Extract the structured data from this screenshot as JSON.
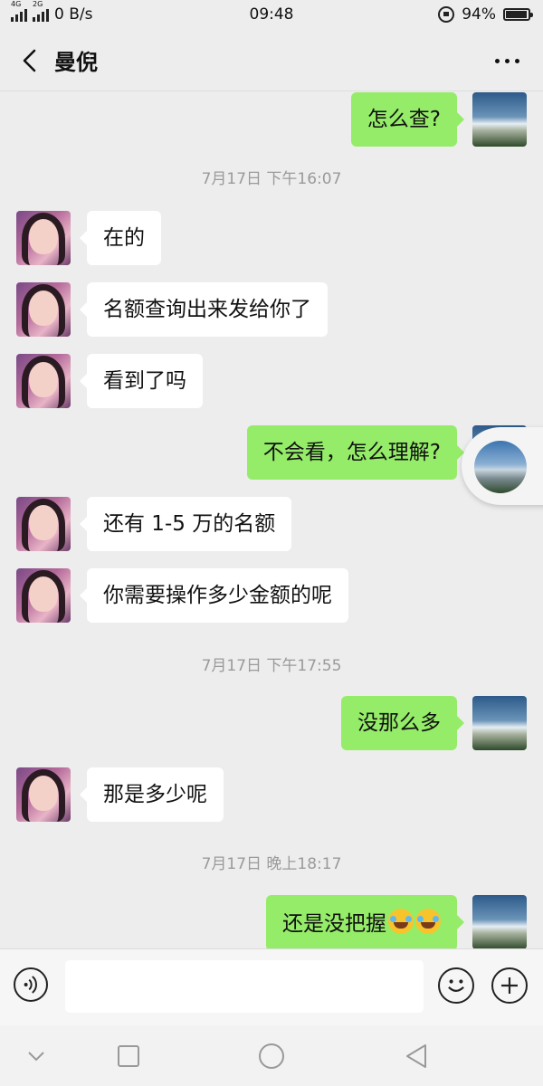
{
  "status_bar": {
    "net1": "4G",
    "net2": "2G",
    "speed": "0 B/s",
    "time": "09:48",
    "battery": "94%",
    "battery_level": 0.94
  },
  "header": {
    "title": "曼倪"
  },
  "messages": [
    {
      "side": "right",
      "text": "怎么查?"
    },
    {
      "type": "time",
      "text": "7月17日 下午16:07"
    },
    {
      "side": "left",
      "text": "在的"
    },
    {
      "side": "left",
      "text": "名额查询出来发给你了"
    },
    {
      "side": "left",
      "text": "看到了吗"
    },
    {
      "side": "right",
      "text": "不会看，怎么理解?"
    },
    {
      "side": "left",
      "text": "还有 1-5 万的名额"
    },
    {
      "side": "left",
      "text": "你需要操作多少金额的呢"
    },
    {
      "type": "time",
      "text": "7月17日 下午17:55"
    },
    {
      "side": "right",
      "text": "没那么多"
    },
    {
      "side": "left",
      "text": "那是多少呢"
    },
    {
      "type": "time",
      "text": "7月17日 晚上18:17"
    },
    {
      "side": "right",
      "text": "还是没把握"
    }
  ],
  "icons": {
    "back": "back-arrow-icon",
    "more": "more-dots-icon",
    "voice": "voice-icon",
    "emoji": "emoji-icon",
    "plus": "plus-icon",
    "emoji_in_message": "rolling-on-floor-laughing-emoji"
  },
  "colors": {
    "sent_bubble": "#95ec69",
    "received_bubble": "#ffffff",
    "background": "#ededed"
  },
  "input": {
    "value": ""
  }
}
